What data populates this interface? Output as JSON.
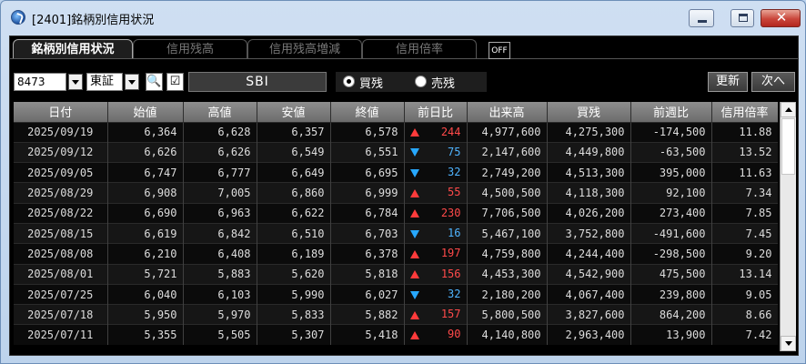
{
  "window": {
    "title": "[2401]銘柄別信用状況",
    "close_glyph": "✕"
  },
  "tabs": [
    {
      "label": "銘柄別信用状況",
      "active": true
    },
    {
      "label": "信用残高",
      "active": false
    },
    {
      "label": "信用残高増減",
      "active": false
    },
    {
      "label": "信用倍率",
      "active": false
    }
  ],
  "off_badge": "OFF",
  "toolbar": {
    "code": "8473",
    "market": "東証",
    "search_icon": "🔍",
    "edit_icon": "☑",
    "broker": "SBI",
    "radio_buy": "買残",
    "radio_sell": "売残",
    "selected_radio": "買残",
    "refresh_label": "更新",
    "next_label": "次へ"
  },
  "table": {
    "headers": [
      "日付",
      "始値",
      "高値",
      "安値",
      "終値",
      "前日比",
      "出来高",
      "買残",
      "前週比",
      "信用倍率"
    ],
    "rows": [
      {
        "date": "2025/09/19",
        "open": "6,364",
        "high": "6,628",
        "low": "6,357",
        "close": "6,578",
        "dir": "up",
        "change": "244",
        "volume": "4,977,600",
        "buy": "4,275,300",
        "week": "-174,500",
        "ratio": "11.88"
      },
      {
        "date": "2025/09/12",
        "open": "6,626",
        "high": "6,626",
        "low": "6,549",
        "close": "6,551",
        "dir": "down",
        "change": "75",
        "volume": "2,147,600",
        "buy": "4,449,800",
        "week": "-63,500",
        "ratio": "13.52"
      },
      {
        "date": "2025/09/05",
        "open": "6,747",
        "high": "6,777",
        "low": "6,649",
        "close": "6,695",
        "dir": "down",
        "change": "32",
        "volume": "2,749,200",
        "buy": "4,513,300",
        "week": "395,000",
        "ratio": "11.63"
      },
      {
        "date": "2025/08/29",
        "open": "6,908",
        "high": "7,005",
        "low": "6,860",
        "close": "6,999",
        "dir": "up",
        "change": "55",
        "volume": "4,500,500",
        "buy": "4,118,300",
        "week": "92,100",
        "ratio": "7.34"
      },
      {
        "date": "2025/08/22",
        "open": "6,690",
        "high": "6,963",
        "low": "6,622",
        "close": "6,784",
        "dir": "up",
        "change": "230",
        "volume": "7,706,500",
        "buy": "4,026,200",
        "week": "273,400",
        "ratio": "7.85"
      },
      {
        "date": "2025/08/15",
        "open": "6,619",
        "high": "6,842",
        "low": "6,510",
        "close": "6,703",
        "dir": "down",
        "change": "16",
        "volume": "5,467,100",
        "buy": "3,752,800",
        "week": "-491,600",
        "ratio": "7.45"
      },
      {
        "date": "2025/08/08",
        "open": "6,210",
        "high": "6,408",
        "low": "6,189",
        "close": "6,378",
        "dir": "up",
        "change": "197",
        "volume": "4,759,800",
        "buy": "4,244,400",
        "week": "-298,500",
        "ratio": "9.20"
      },
      {
        "date": "2025/08/01",
        "open": "5,721",
        "high": "5,883",
        "low": "5,620",
        "close": "5,818",
        "dir": "up",
        "change": "156",
        "volume": "4,453,300",
        "buy": "4,542,900",
        "week": "475,500",
        "ratio": "13.14"
      },
      {
        "date": "2025/07/25",
        "open": "6,040",
        "high": "6,103",
        "low": "5,990",
        "close": "6,027",
        "dir": "down",
        "change": "32",
        "volume": "2,180,200",
        "buy": "4,067,400",
        "week": "239,800",
        "ratio": "9.05"
      },
      {
        "date": "2025/07/18",
        "open": "5,950",
        "high": "5,970",
        "low": "5,833",
        "close": "5,882",
        "dir": "up",
        "change": "157",
        "volume": "5,800,500",
        "buy": "3,827,600",
        "week": "864,200",
        "ratio": "8.66"
      },
      {
        "date": "2025/07/11",
        "open": "5,355",
        "high": "5,505",
        "low": "5,307",
        "close": "5,418",
        "dir": "up",
        "change": "90",
        "volume": "4,140,800",
        "buy": "2,963,400",
        "week": "13,900",
        "ratio": "7.42"
      }
    ]
  },
  "colors": {
    "up": "#ff4a4a",
    "down": "#4fb4ff"
  }
}
